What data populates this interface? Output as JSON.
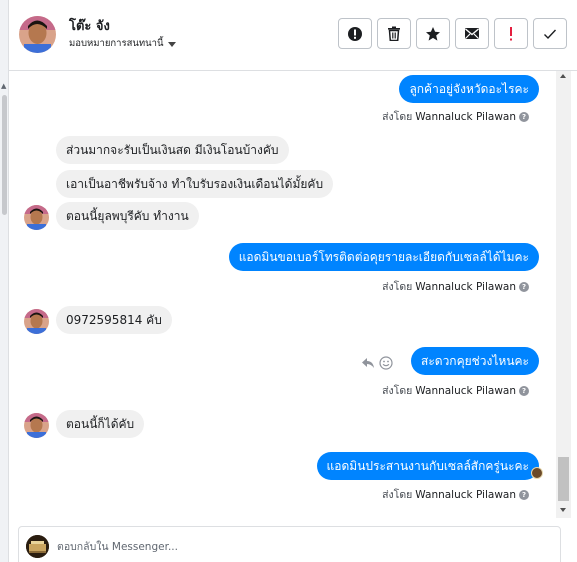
{
  "header": {
    "contact_name": "โต๊ะ จัง",
    "assign_label": "มอบหมายการสนทนานี้"
  },
  "toolbar": {
    "spam_icon": "exclamation-circle-icon",
    "delete_icon": "trash-icon",
    "star_icon": "star-icon",
    "unread_icon": "envelope-icon",
    "important_icon": "exclamation-icon",
    "done_icon": "check-icon",
    "important_color": "#e41e3f"
  },
  "thread": {
    "sent_by_prefix": "ส่งโดย",
    "messages": [
      {
        "direction": "out",
        "text": "ลูกค้าอยู่จังหวัดอะไรคะ",
        "sender": "Wannaluck Pilawan"
      },
      {
        "direction": "in",
        "text": "ส่วนมากจะรับเป็นเงินสด มีเงินโอนบ้างคับ"
      },
      {
        "direction": "in",
        "text": "เอาเป็นอาชีพรับจ้าง ทำใบรับรองเงินเดือนได้มั้ยคับ"
      },
      {
        "direction": "in",
        "text": "ตอนนี้ยุลพบุรีคับ ทำงาน"
      },
      {
        "direction": "out",
        "text": "แอดมินขอเบอร์โทรติดต่อคุยรายละเอียดกับเซลล์ได้ไมคะ",
        "sender": "Wannaluck Pilawan"
      },
      {
        "direction": "in",
        "text": "0972595814 คับ"
      },
      {
        "direction": "out",
        "text": "สะดวกคุยช่วงไหนคะ",
        "sender": "Wannaluck Pilawan"
      },
      {
        "direction": "in",
        "text": "ตอนนี้ก็ได้คับ"
      },
      {
        "direction": "out",
        "text": "แอดมินประสานงานกับเซลล์สักครู่นะคะ",
        "sender": "Wannaluck Pilawan"
      }
    ]
  },
  "composer": {
    "placeholder": "ตอบกลับใน Messenger..."
  },
  "colors": {
    "outgoing_bubble": "#0084ff",
    "incoming_bubble": "#f0f0f0"
  }
}
